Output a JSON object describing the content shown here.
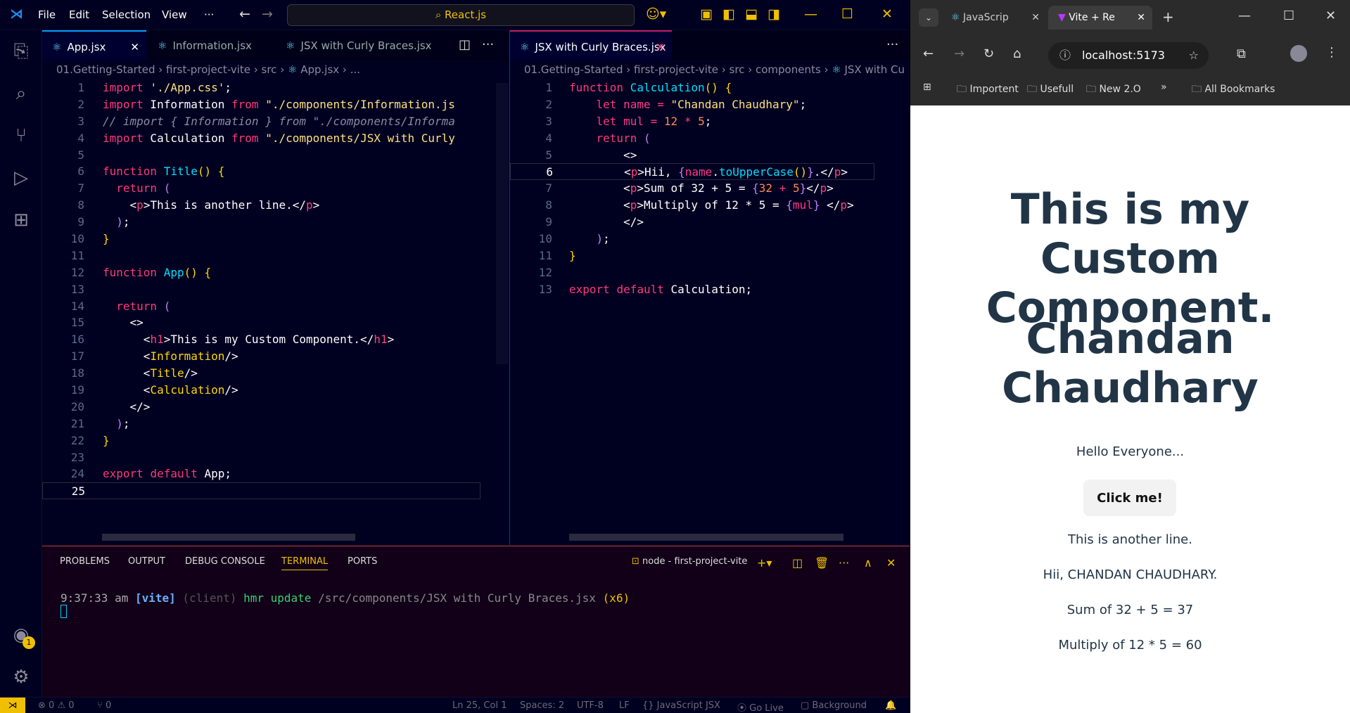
{
  "vscode": {
    "menu": [
      "File",
      "Edit",
      "Selection",
      "View",
      "···"
    ],
    "command_center": "React.js",
    "left_tabs": [
      "App.jsx",
      "Information.jsx",
      "JSX with Curly Braces.jsx"
    ],
    "right_tabs": [
      "JSX with Curly Braces.jsx"
    ],
    "left_breadcrumb": [
      "01.Getting-Started",
      "first-project-vite",
      "src",
      "App.jsx",
      "..."
    ],
    "right_breadcrumb": [
      "01.Getting-Started",
      "first-project-vite",
      "src",
      "components",
      "JSX with Cu"
    ],
    "panel_tabs": [
      "PROBLEMS",
      "OUTPUT",
      "DEBUG CONSOLE",
      "TERMINAL",
      "PORTS"
    ],
    "terminal_name": "node - first-project-vite",
    "terminal_line": {
      "time": "9:37:33 am",
      "tag": "[vite]",
      "client": "(client)",
      "msg": "hmr update",
      "path": "/src/components/JSX with Curly Braces.jsx",
      "count": "(x6)"
    },
    "status": {
      "errors": "0",
      "warnings": "0",
      "ports": "0",
      "cursor": "Ln 25, Col 1",
      "spaces": "Spaces: 2",
      "encoding": "UTF-8",
      "eol": "LF",
      "lang": "{} JavaScript JSX",
      "golive": "Go Live",
      "bg": "Background"
    },
    "accounts_badge": "1"
  },
  "chrome": {
    "tabs": [
      "JavaScrip",
      "Vite + Re"
    ],
    "url": "localhost:5173",
    "bookmarks": [
      "Importent",
      "Usefull",
      "New 2.O",
      "All Bookmarks"
    ],
    "page": {
      "h1_a": "This is my Custom Component.",
      "h1_b": "Chandan Chaudhary",
      "hello": "Hello Everyone...",
      "button": "Click me!",
      "another": "This is another line.",
      "hii": "Hii, CHANDAN CHAUDHARY.",
      "sum": "Sum of 32 + 5 = 37",
      "mul": "Multiply of 12 * 5 = 60"
    }
  }
}
